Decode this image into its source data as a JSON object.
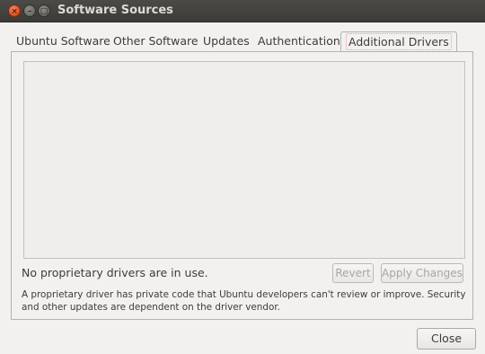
{
  "window": {
    "title": "Software Sources"
  },
  "tabs": [
    {
      "label": "Ubuntu Software"
    },
    {
      "label": "Other Software"
    },
    {
      "label": "Updates"
    },
    {
      "label": "Authentication"
    },
    {
      "label": "Additional Drivers",
      "active": true
    }
  ],
  "drivers": {
    "status": "No proprietary drivers are in use.",
    "revert_label": "Revert",
    "apply_label": "Apply Changes",
    "note": "A proprietary driver has private code that Ubuntu developers can't review or improve. Security and other updates are dependent on the driver vendor."
  },
  "footer": {
    "close_label": "Close"
  }
}
